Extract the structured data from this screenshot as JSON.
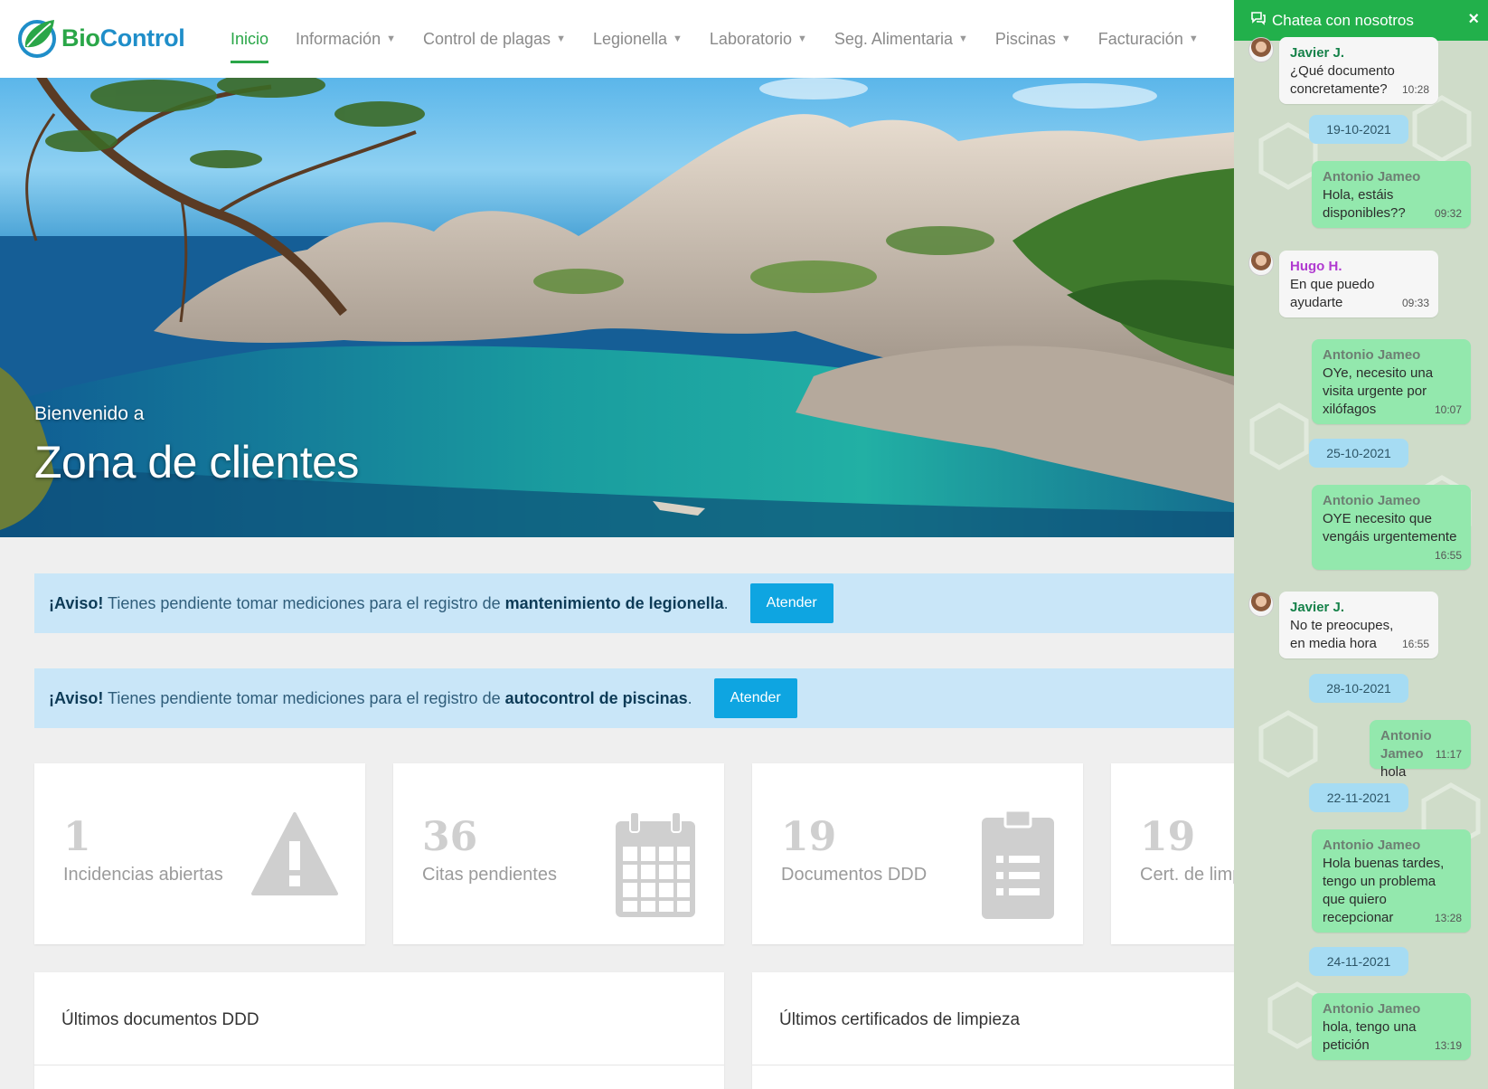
{
  "nav": {
    "logo_bio": "Bio",
    "logo_control": "Control",
    "items": [
      {
        "label": "Inicio",
        "active": true
      },
      {
        "label": "Información"
      },
      {
        "label": "Control de plagas"
      },
      {
        "label": "Legionella"
      },
      {
        "label": "Laboratorio"
      },
      {
        "label": "Seg. Alimentaria"
      },
      {
        "label": "Piscinas"
      },
      {
        "label": "Facturación"
      }
    ]
  },
  "hero": {
    "subtitle": "Bienvenido a",
    "title": "Zona de clientes"
  },
  "alerts": [
    {
      "prefix": "¡Aviso!",
      "text": " Tienes pendiente tomar mediciones para el registro de ",
      "target": "mantenimiento de legionella",
      "suffix": ".",
      "button": "Atender"
    },
    {
      "prefix": "¡Aviso!",
      "text": " Tienes pendiente tomar mediciones para el registro de ",
      "target": "autocontrol de piscinas",
      "suffix": ".",
      "button": "Atender"
    }
  ],
  "stats": [
    {
      "value": "1",
      "label": "Incidencias abiertas",
      "icon": "warning-icon"
    },
    {
      "value": "36",
      "label": "Citas pendientes",
      "icon": "calendar-icon"
    },
    {
      "value": "19",
      "label": "Documentos DDD",
      "icon": "clipboard-icon"
    },
    {
      "value": "19",
      "label": "Cert. de limp",
      "icon": "certificate-icon"
    }
  ],
  "panels": [
    {
      "title": "Últimos documentos DDD"
    },
    {
      "title": "Últimos certificados de limpieza"
    }
  ],
  "chat": {
    "title": "Chatea con nosotros",
    "close": "×",
    "messages": [
      {
        "type": "in",
        "author": "Javier J.",
        "text": "¿Qué documento concretamente?",
        "time": "10:28"
      },
      {
        "type": "date",
        "text": "19-10-2021"
      },
      {
        "type": "out",
        "author": "Antonio Jameo",
        "text": "Hola, estáis disponibles??",
        "time": "09:32"
      },
      {
        "type": "in",
        "author": "Hugo H.",
        "text": "En que puedo ayudarte",
        "time": "09:33"
      },
      {
        "type": "out",
        "author": "Antonio Jameo",
        "text": "OYe, necesito una visita urgente por xilófagos",
        "time": "10:07"
      },
      {
        "type": "date",
        "text": "25-10-2021"
      },
      {
        "type": "out",
        "author": "Antonio Jameo",
        "text": "OYE necesito que vengáis urgentemente",
        "time": "16:55"
      },
      {
        "type": "in",
        "author": "Javier J.",
        "text": "No te preocupes, en media hora",
        "time": "16:55"
      },
      {
        "type": "date",
        "text": "28-10-2021"
      },
      {
        "type": "out",
        "author": "Antonio Jameo",
        "text": "hola",
        "time": "11:17"
      },
      {
        "type": "date",
        "text": "22-11-2021"
      },
      {
        "type": "out",
        "author": "Antonio Jameo",
        "text": "Hola buenas tardes, tengo un problema que quiero recepcionar",
        "time": "13:28"
      },
      {
        "type": "date",
        "text": "24-11-2021"
      },
      {
        "type": "out",
        "author": "Antonio Jameo",
        "text": "hola, tengo una petición",
        "time": "13:19"
      }
    ]
  },
  "colors": {
    "brand_green": "#2aa648",
    "brand_blue": "#1f8ec9",
    "button_blue": "#0ea5e1",
    "chat_header": "#22b04b",
    "bubble_out": "#93e8ad"
  }
}
